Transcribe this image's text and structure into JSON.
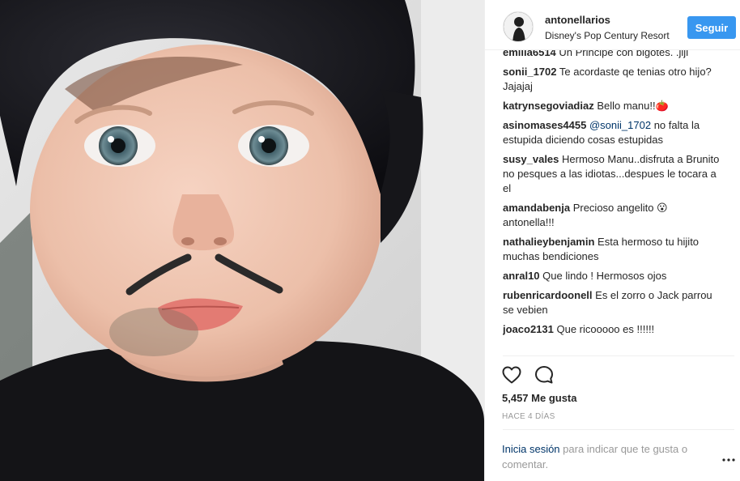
{
  "header": {
    "username": "antonellarios",
    "location": "Disney's Pop Century Resort",
    "follow_label": "Seguir"
  },
  "comments": [
    {
      "user": "emilia6514",
      "text": " Un Principe con bigotes. .jiji"
    },
    {
      "user": "sonii_1702",
      "text": " Te acordaste qe tenias otro hijo? Jajajaj"
    },
    {
      "user": "katrynsegoviadiaz",
      "text": " Bello manu!!🍅"
    },
    {
      "user": "asinomases4455",
      "mention": "@sonii_1702",
      "text": " no falta la estupida diciendo cosas estupidas"
    },
    {
      "user": "susy_vales",
      "text": " Hermoso Manu..disfruta a Brunito no pesques a las idiotas...despues le tocara a el"
    },
    {
      "user": "amandabenja",
      "text": " Precioso angelito 😮 antonella!!!"
    },
    {
      "user": "nathalieybenjamin",
      "text": " Esta hermoso tu hijito muchas bendiciones"
    },
    {
      "user": "anral10",
      "text": " Que lindo ! Hermosos ojos"
    },
    {
      "user": "rubenricardoonell",
      "text": " Es el zorro o Jack parrou se vebien"
    },
    {
      "user": "joaco2131",
      "text": " Que ricooooo es !!!!!!"
    }
  ],
  "likes": "5,457 Me gusta",
  "timestamp": "HACE 4 DÍAS",
  "login": {
    "link": "Inicia sesión",
    "text": " para indicar que te gusta o comentar."
  },
  "icons": {
    "like": "heart-icon",
    "comment": "comment-bubble-icon",
    "more": "more-options-icon"
  },
  "colors": {
    "accent": "#3897f0",
    "link": "#003569",
    "muted": "#999999"
  }
}
